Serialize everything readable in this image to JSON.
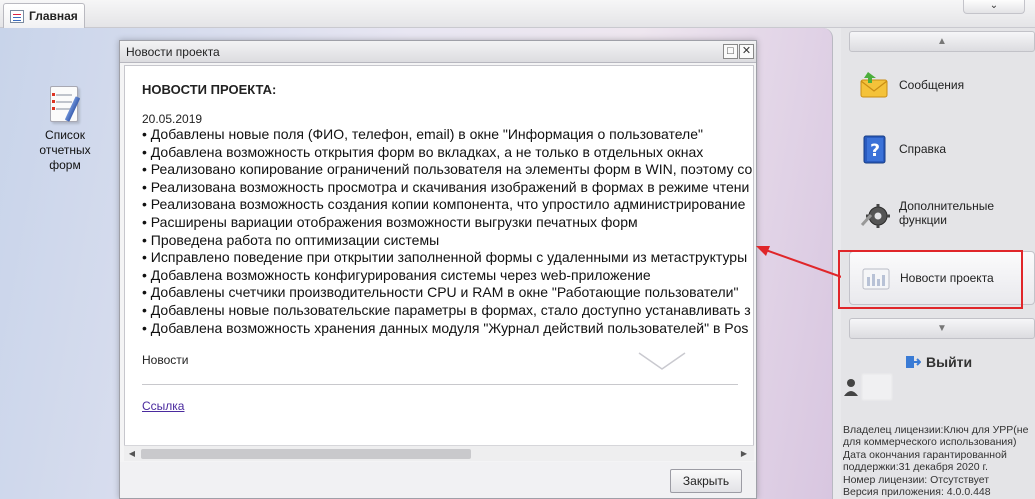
{
  "topbar": {
    "tab_label": "Главная",
    "chevron_glyph": "⌄"
  },
  "desktop": {
    "icon": {
      "name": "report-forms-icon",
      "label_line1": "Список",
      "label_line2": "отчетных",
      "label_line3": "форм"
    }
  },
  "dialog": {
    "title": "Новости проекта",
    "heading": "НОВОСТИ ПРОЕКТА:",
    "date": "20.05.2019",
    "items": [
      "Добавлены новые поля (ФИО, телефон, email) в окне  \"Информация о пользователе\"",
      "Добавлена возможность открытия форм во вкладках, а не  только в отдельных окнах",
      "Реализовано копирование ограничений пользователя на  элементы форм в WIN, поэтому со",
      "Реализована возможность просмотра и скачивания  изображений в формах в режиме чтени",
      "Реализована возможность создания копии компонента,  что упростило администрирование",
      "Расширены вариации отображения возможности выгрузки  печатных форм",
      "Проведена работа по оптимизации системы",
      "Исправлено поведение при открытии заполненной формы  с удаленными из метаструктуры",
      "Добавлена возможность конфигурирования системы через  web-приложение",
      "Добавлены счетчики производительности CPU и RAM в  окне \"Работающие пользователи\"",
      "Добавлены новые пользовательские параметры в формах,  стало доступно устанавливать з",
      "Добавлена возможность хранения данных модуля \"Журнал  действий пользователей\" в Pos"
    ],
    "footer_label": "Новости",
    "link_text": "Ссылка",
    "close_button": "Закрыть",
    "maximize_glyph": "□",
    "close_glyph": "✕"
  },
  "right_panel": {
    "scroll_up_glyph": "▲",
    "scroll_down_glyph": "▼",
    "menu": [
      {
        "label": "Сообщения",
        "icon": "envelope-icon"
      },
      {
        "label": "Справка",
        "icon": "help-book-icon"
      },
      {
        "label": "Дополнительные функции",
        "icon": "gear-icon"
      },
      {
        "label": "Новости проекта",
        "icon": "news-icon"
      }
    ],
    "exit_label": "Выйти",
    "license_lines": [
      "Владелец лицензии:Ключ для УРР(не",
      "для коммерческого использования)",
      "Дата окончания гарантированной",
      "поддержки:31 декабря 2020 г.",
      "Номер лицензии: Отсутствует",
      "Версия приложения: 4.0.0.448"
    ]
  },
  "colors": {
    "highlight": "#e0262a",
    "link": "#4a2a9e"
  }
}
